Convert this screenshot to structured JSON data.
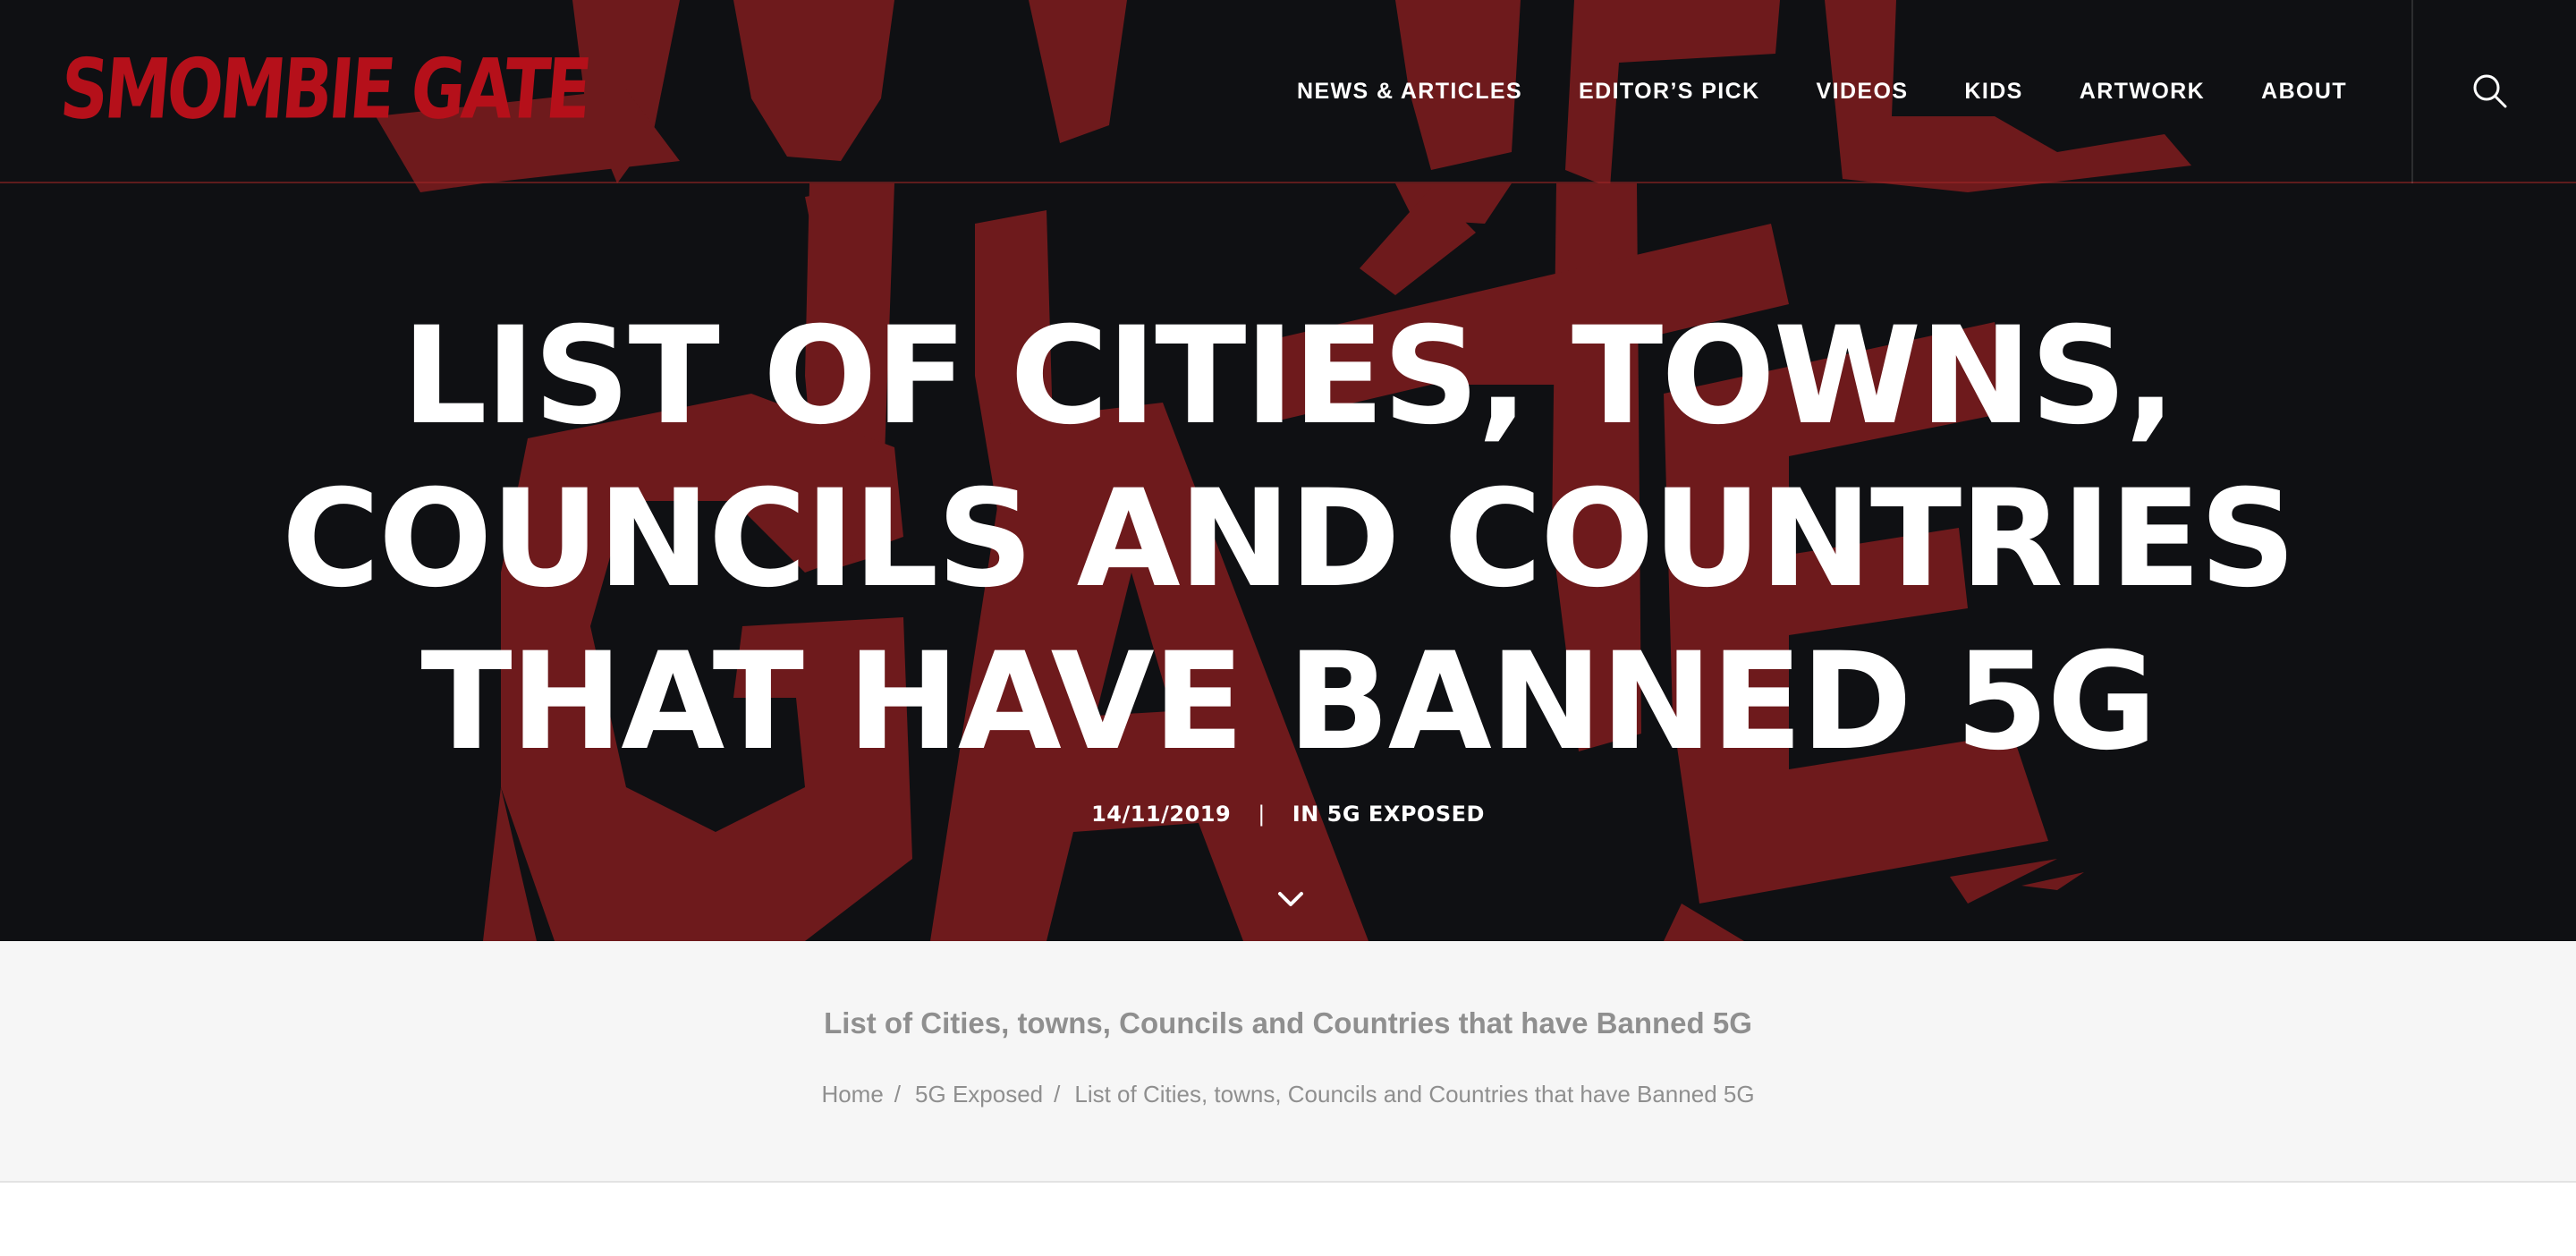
{
  "site": {
    "logo_text": "SMOMBIE GATE",
    "brand_color": "#b5101a"
  },
  "nav": {
    "items": [
      {
        "label": "NEWS & ARTICLES"
      },
      {
        "label": "EDITOR’S PICK"
      },
      {
        "label": "VIDEOS"
      },
      {
        "label": "KIDS"
      },
      {
        "label": "ARTWORK"
      },
      {
        "label": "ABOUT"
      }
    ],
    "search_icon": "search-icon"
  },
  "hero": {
    "title_lines": [
      "LIST OF CITIES, TOWNS,",
      "COUNCILS AND COUNTRIES",
      "THAT HAVE BANNED 5G"
    ],
    "date": "14/11/2019",
    "separator": "|",
    "category": "IN 5G EXPOSED",
    "scroll_icon": "chevron-down-icon",
    "background_color": "#0f1013",
    "art_color": "#6e1a1c"
  },
  "titlebar": {
    "heading": "List of Cities, towns, Councils and Countries that have Banned 5G",
    "breadcrumb": {
      "home": "Home",
      "category": "5G Exposed",
      "current": "List of Cities, towns, Councils and Countries that have Banned 5G",
      "separator": "/"
    }
  }
}
